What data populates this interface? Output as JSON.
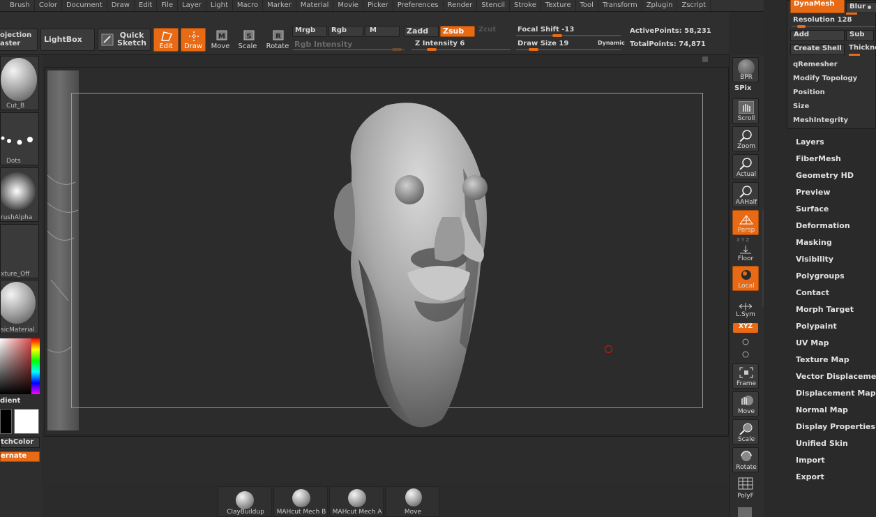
{
  "menu": [
    "Brush",
    "Color",
    "Document",
    "Draw",
    "Edit",
    "File",
    "Layer",
    "Light",
    "Macro",
    "Marker",
    "Material",
    "Movie",
    "Picker",
    "Preferences",
    "Render",
    "Stencil",
    "Stroke",
    "Texture",
    "Tool",
    "Transform",
    "Zplugin",
    "Zscript"
  ],
  "toolbar": {
    "projection_master": "Projection Master",
    "projection_line1": "ojection",
    "projection_line2": "aster",
    "lightbox": "LightBox",
    "quick_sketch_1": "Quick",
    "quick_sketch_2": "Sketch",
    "edit": "Edit",
    "draw": "Draw",
    "move": "Move",
    "scale": "Scale",
    "rotate": "Rotate",
    "mrgb": "Mrgb",
    "rgb": "Rgb",
    "m": "M",
    "zadd": "Zadd",
    "zsub": "Zsub",
    "zcut": "Zcut",
    "rgb_intensity": "Rgb Intensity",
    "z_intensity_label": "Z Intensity",
    "z_intensity_value": "6",
    "focal_shift_label": "Focal Shift",
    "focal_shift_value": "-13",
    "draw_size_label": "Draw Size",
    "draw_size_value": "19",
    "dynamic": "Dynamic",
    "active_points_label": "ActivePoints:",
    "active_points_value": "58,231",
    "total_points_label": "TotalPoints:",
    "total_points_value": "74,871"
  },
  "left_shelf": {
    "brush": "Cut_B",
    "stroke": "Dots",
    "alpha": "rushAlpha",
    "texture": "xture_Off",
    "material": "sicMaterial",
    "gradient": "dient",
    "switch_color": "tchColor",
    "alternate": "ernate"
  },
  "right_shelf": {
    "bpr": "BPR",
    "spix": "SPix",
    "scroll": "Scroll",
    "zoom": "Zoom",
    "actual": "Actual",
    "aahalf": "AAHalf",
    "persp": "Persp",
    "floor_axes": "X Y Z",
    "floor": "Floor",
    "local": "Local",
    "lsym": "L.Sym",
    "xyz": "XYZ",
    "frame": "Frame",
    "move": "Move",
    "scale": "Scale",
    "rotate": "Rotate",
    "polyf": "PolyF"
  },
  "subtool": {
    "dynamesh": "DynaMesh",
    "blur": "Blur",
    "resolution_label": "Resolution",
    "resolution_value": "128",
    "add": "Add",
    "sub": "Sub",
    "create_shell": "Create Shell",
    "thickness": "Thickne",
    "items": [
      "qRemesher",
      "Modify Topology",
      "Position",
      "Size",
      "MeshIntegrity"
    ]
  },
  "tool_menu": [
    "Layers",
    "FiberMesh",
    "Geometry HD",
    "Preview",
    "Surface",
    "Deformation",
    "Masking",
    "Visibility",
    "Polygroups",
    "Contact",
    "Morph Target",
    "Polypaint",
    "UV Map",
    "Texture Map",
    "Vector Displacement",
    "Displacement Map",
    "Normal Map",
    "Display Properties",
    "Unified Skin",
    "Import",
    "Export"
  ],
  "brush_tray": [
    {
      "label": "ClayBuildup"
    },
    {
      "label": "MAHcut Mech B"
    },
    {
      "label": "MAHcut Mech A"
    },
    {
      "label": "Move"
    }
  ],
  "colors": {
    "accent": "#e86a15",
    "background": "#2b2b2b",
    "panel": "#2f2f2f"
  }
}
